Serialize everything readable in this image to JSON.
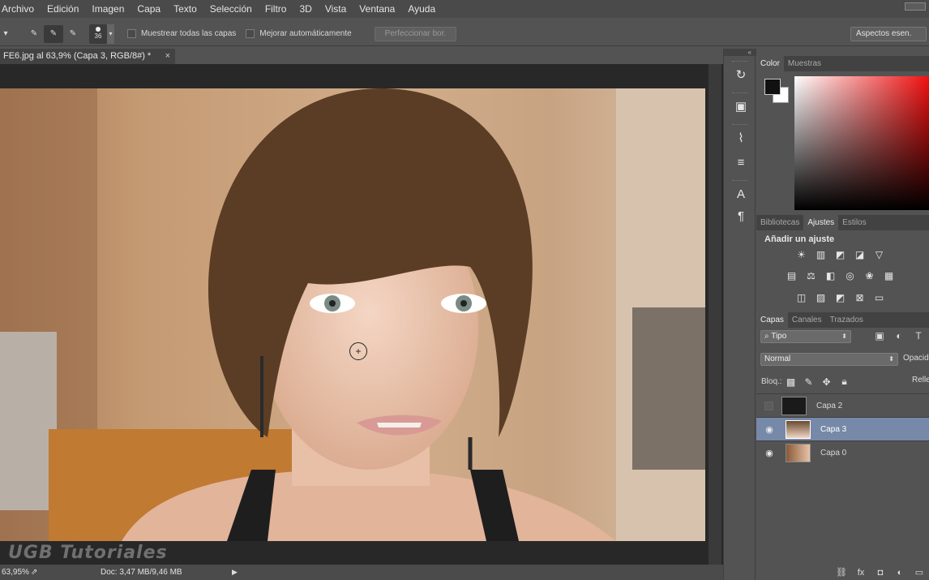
{
  "menu": [
    "Archivo",
    "Edición",
    "Imagen",
    "Capa",
    "Texto",
    "Selección",
    "Filtro",
    "3D",
    "Vista",
    "Ventana",
    "Ayuda"
  ],
  "options": {
    "brush_size": "36",
    "sample_all_layers": "Muestrear todas las capas",
    "auto_enhance": "Mejorar automáticamente",
    "refine_edge": "Perfeccionar bor.",
    "workspace": "Aspectos esen."
  },
  "document": {
    "tab_title": "FE6.jpg al 63,9% (Capa 3, RGB/8#) *",
    "close": "×"
  },
  "status": {
    "zoom": "63,95%",
    "doc_size": "Doc: 3,47 MB/9,46 MB"
  },
  "watermark": "UGB Tutoriales",
  "color_panel": {
    "tabs": [
      "Color",
      "Muestras"
    ],
    "foreground": "#111111",
    "background": "#ffffff"
  },
  "adjust_panel": {
    "tabs": [
      "Bibliotecas",
      "Ajustes",
      "Estilos"
    ],
    "title": "Añadir un ajuste"
  },
  "layers_panel": {
    "tabs": [
      "Capas",
      "Canales",
      "Trazados"
    ],
    "filter": "Tipo",
    "blend_mode": "Normal",
    "opacity_label": "Opacid",
    "lock_label": "Bloq.:",
    "fill_label": "Relle",
    "layers": [
      {
        "name": "Capa 2",
        "visible": false,
        "selected": false
      },
      {
        "name": "Capa 3",
        "visible": true,
        "selected": true
      },
      {
        "name": "Capa 0",
        "visible": true,
        "selected": false
      }
    ]
  },
  "colors": {
    "ui_bg": "#535353",
    "selected_layer": "#7789a8",
    "canvas_bg": "#282828"
  }
}
